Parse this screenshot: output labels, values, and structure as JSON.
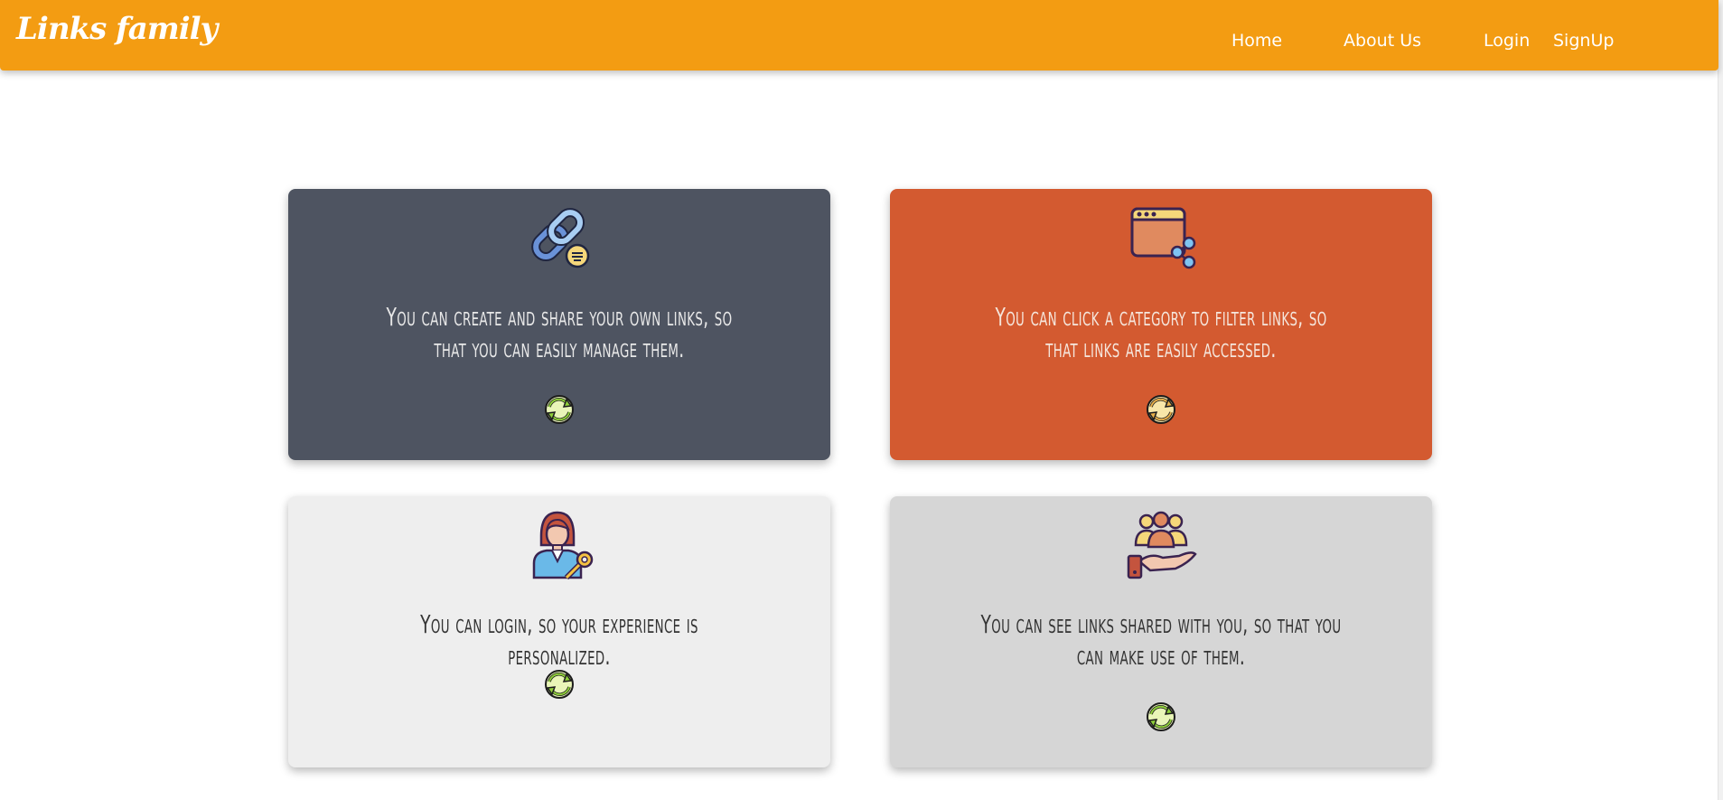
{
  "navbar": {
    "brand": "Links family",
    "links": [
      {
        "label": "Home"
      },
      {
        "label": "About Us"
      },
      {
        "label": "Login"
      },
      {
        "label": "SignUp"
      }
    ],
    "color": "#f39c12"
  },
  "cards": [
    {
      "text": "You can create and share your own links, so that you can easily manage them.",
      "icon": "chain-link-icon",
      "background": "#4e5461",
      "text_color": "#e8e8e8"
    },
    {
      "text": "You can click a category to filter links, so that links are easily accessed.",
      "icon": "browser-share-icon",
      "background": "#d35a30",
      "text_color": "#f5e6dc"
    },
    {
      "text": "You can login, so your experience is personalized.",
      "icon": "user-key-icon",
      "background": "#eeeeee",
      "text_color": "#333333"
    },
    {
      "text": "You can see links shared with you, so that you can make use of them.",
      "icon": "people-in-hand-icon",
      "background": "#d6d6d6",
      "text_color": "#333333"
    }
  ],
  "refresh_icon": "refresh-icon"
}
